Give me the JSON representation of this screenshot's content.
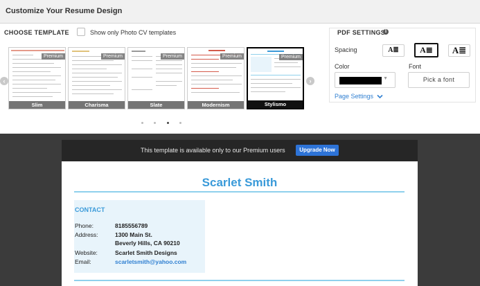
{
  "header": {
    "title": "Customize Your Resume Design"
  },
  "templates": {
    "heading": "CHOOSE TEMPLATE",
    "photo_filter_label": "Show only Photo CV templates",
    "items": [
      {
        "name": "Slim",
        "badge": "Premium"
      },
      {
        "name": "Charisma",
        "badge": "Premium"
      },
      {
        "name": "Slate",
        "badge": "Premium"
      },
      {
        "name": "Modernism",
        "badge": "Premium"
      },
      {
        "name": "Stylismo",
        "badge": "Premium"
      }
    ],
    "selected": "Stylismo",
    "pagination": {
      "pages": 4,
      "active": 3
    }
  },
  "pdf_settings": {
    "title": "PDF SETTINGS",
    "info_icon": "i",
    "spacing_label": "Spacing",
    "spacing_options": [
      {
        "glyph": "A≣",
        "selected": false
      },
      {
        "glyph": "A≣",
        "selected": true
      },
      {
        "glyph": "A≣",
        "selected": false
      }
    ],
    "color_label": "Color",
    "color_value": "#000000",
    "font_label": "Font",
    "font_button": "Pick a font",
    "page_settings_link": "Page Settings"
  },
  "preview": {
    "premium_notice": "This template is available only to our Premium users",
    "upgrade_label": "Upgrade Now",
    "resume": {
      "name": "Scarlet Smith",
      "contact_heading": "CONTACT",
      "fields": {
        "phone_label": "Phone:",
        "phone": "8185556789",
        "address_label": "Address:",
        "address_line1": "1300 Main St.",
        "address_line2": "Beverly Hills, CA 90210",
        "website_label": "Website:",
        "website": "Scarlet Smith Designs",
        "email_label": "Email:",
        "email": "scarletsmith@yahoo.com"
      }
    }
  },
  "colors": {
    "accent_blue": "#3a9ad9",
    "button_blue": "#2d73d7",
    "link_blue": "#2f7fd1",
    "rule_blue": "#8fd0ec"
  }
}
